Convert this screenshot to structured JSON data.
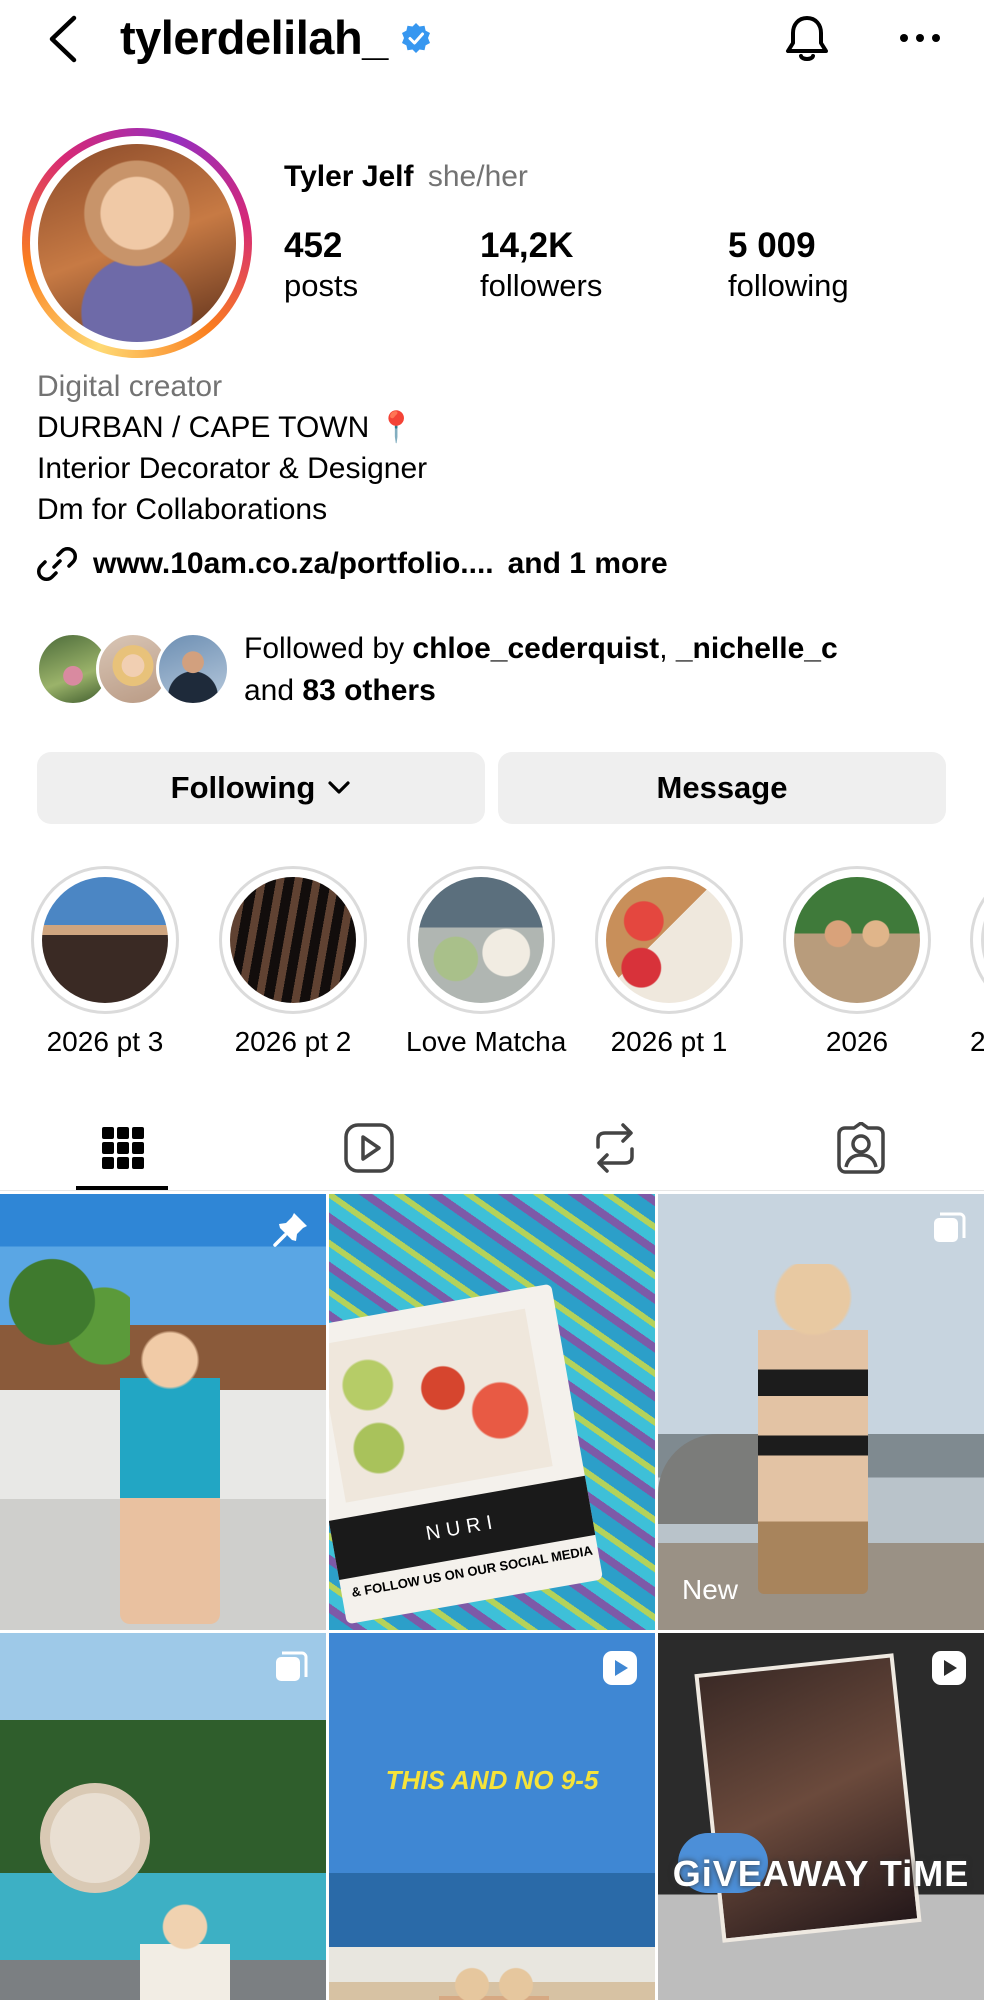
{
  "header": {
    "username": "tylerdelilah_",
    "back_icon": "chevron-left-icon",
    "verified_icon": "verified-badge-icon",
    "notifications_icon": "bell-icon",
    "more_icon": "ellipsis-icon",
    "verified_color": "#3797F0"
  },
  "profile": {
    "name": "Tyler Jelf",
    "pronouns": "she/her",
    "stats": {
      "posts_count": "452",
      "posts_label": "posts",
      "followers_count": "14,2K",
      "followers_label": "followers",
      "following_count": "5 009",
      "following_label": "following"
    },
    "category": "Digital creator",
    "bio": {
      "line1": "DURBAN / CAPE TOWN 📍",
      "line2": "Interior Decorator & Designer",
      "line3": "Dm for Collaborations"
    },
    "link": {
      "icon": "link-icon",
      "url": "www.10am.co.za/portfolio....",
      "more": "and 1 more"
    },
    "followed_by": {
      "prefix": "Followed by ",
      "user1": "chloe_cederquist",
      "separator": ", ",
      "user2": "_nichelle_c",
      "and_text": "and ",
      "others": "83 others"
    }
  },
  "actions": {
    "following_label": "Following",
    "following_icon": "chevron-down-icon",
    "message_label": "Message"
  },
  "highlights": [
    {
      "label": "2026 pt 3"
    },
    {
      "label": "2026 pt 2"
    },
    {
      "label": "Love Matcha"
    },
    {
      "label": "2026 pt 1"
    },
    {
      "label": "2026"
    },
    {
      "label": "2"
    }
  ],
  "tabs": {
    "posts_icon": "grid-icon",
    "reels_icon": "reels-icon",
    "reposts_icon": "repost-icon",
    "tagged_icon": "tagged-icon",
    "active": "posts"
  },
  "grid": {
    "posts": [
      {
        "badge": "pin-icon"
      },
      {
        "badge": "none",
        "text_nuri": "NURI",
        "text_follow": "& FOLLOW US ON OUR SOCIAL MEDIA"
      },
      {
        "badge": "carousel-icon",
        "new_label": "New"
      },
      {
        "badge": "carousel-icon"
      },
      {
        "badge": "reel-icon",
        "caption": "THIS AND NO 9-5"
      },
      {
        "badge": "reel-icon",
        "caption": "GiVEAWAY TiME"
      }
    ]
  }
}
